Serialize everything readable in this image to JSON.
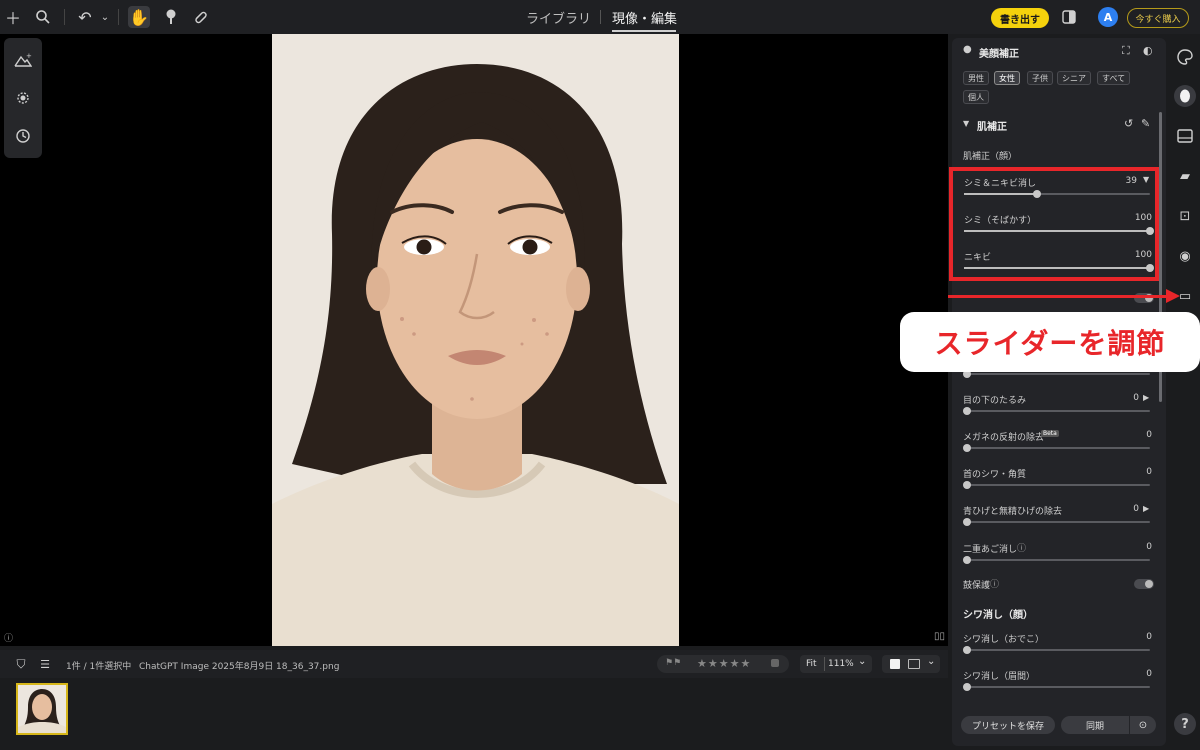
{
  "topbar": {
    "tabs": [
      "ライブラリ",
      "現像・編集"
    ],
    "active_tab": "現像・編集",
    "export_label": "書き出す",
    "avatar_letter": "A",
    "buy_label": "今すぐ購入"
  },
  "filmstrip": {
    "selection_text": "1件 / 1件選択中",
    "filename": "ChatGPT Image 2025年8月9日 18_36_37.png",
    "fit_label": "Fit",
    "zoom": "111%"
  },
  "panel": {
    "header": "美顔補正",
    "chips": [
      "男性",
      "女性",
      "子供",
      "シニア",
      "すべて",
      "個人"
    ],
    "selected_chip": "女性",
    "section_title": "肌補正",
    "subsection": "肌補正（顔）",
    "sliders": [
      {
        "label": "シミ＆ニキビ消し",
        "value": "39",
        "level": 0.39
      },
      {
        "label": "シミ（そばかす）",
        "value": "100",
        "level": 1.0
      },
      {
        "label": "ニキビ",
        "value": "100",
        "level": 1.0
      }
    ],
    "lower_sliders": [
      {
        "label": "目の下のたるみ",
        "value": "0"
      },
      {
        "label": "メガネの反射の除去",
        "value": "0",
        "badge": "Beta"
      },
      {
        "label": "首のシワ・角質",
        "value": "0"
      },
      {
        "label": "青ひげと無精ひげの除去",
        "value": "0"
      },
      {
        "label": "二重あご消し",
        "value": "0"
      }
    ],
    "toggle_label": "鼓保護",
    "wrinkle_section": "シワ消し（顔）",
    "wrinkle_sliders": [
      {
        "label": "シワ消し（おでこ）",
        "value": "0"
      },
      {
        "label": "シワ消し（眉間）",
        "value": "0"
      }
    ],
    "save_preset": "プリセットを保存",
    "sync": "同期"
  },
  "annotation": {
    "callout": "スライダーを調節"
  },
  "colors": {
    "accent_yellow": "#f5d20c",
    "annotation_red": "#e8262a",
    "avatar_blue": "#2d7ff0"
  }
}
